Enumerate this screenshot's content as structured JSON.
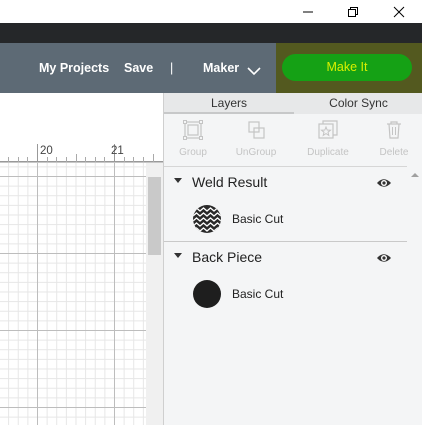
{
  "window": {
    "controls": [
      "minimize-icon",
      "restore-icon",
      "close-icon"
    ]
  },
  "header": {
    "my_projects": "My Projects",
    "save": "Save",
    "separator": "|",
    "machine": "Maker",
    "make_it": "Make It"
  },
  "ruler": {
    "labels": [
      "20",
      "21"
    ]
  },
  "panel": {
    "tabs": [
      {
        "label": "Layers",
        "active": true
      },
      {
        "label": "Color Sync",
        "active": false
      }
    ],
    "actions": [
      {
        "label": "Group",
        "icon": "group-icon",
        "enabled": false
      },
      {
        "label": "UnGroup",
        "icon": "ungroup-icon",
        "enabled": false
      },
      {
        "label": "Duplicate",
        "icon": "duplicate-icon",
        "enabled": false
      },
      {
        "label": "Delete",
        "icon": "trash-icon",
        "enabled": false
      }
    ],
    "groups": [
      {
        "name": "Weld Result",
        "layer": {
          "label": "Basic Cut",
          "swatch": "zigzag-pattern"
        },
        "visible": true
      },
      {
        "name": "Back Piece",
        "layer": {
          "label": "Basic Cut",
          "swatch": "solid-black"
        },
        "visible": true
      }
    ]
  },
  "colors": {
    "topbar": "#5d6a75",
    "make_it_button": "#15a115",
    "make_it_text": "#d8f000",
    "make_it_area": "#53591f"
  }
}
